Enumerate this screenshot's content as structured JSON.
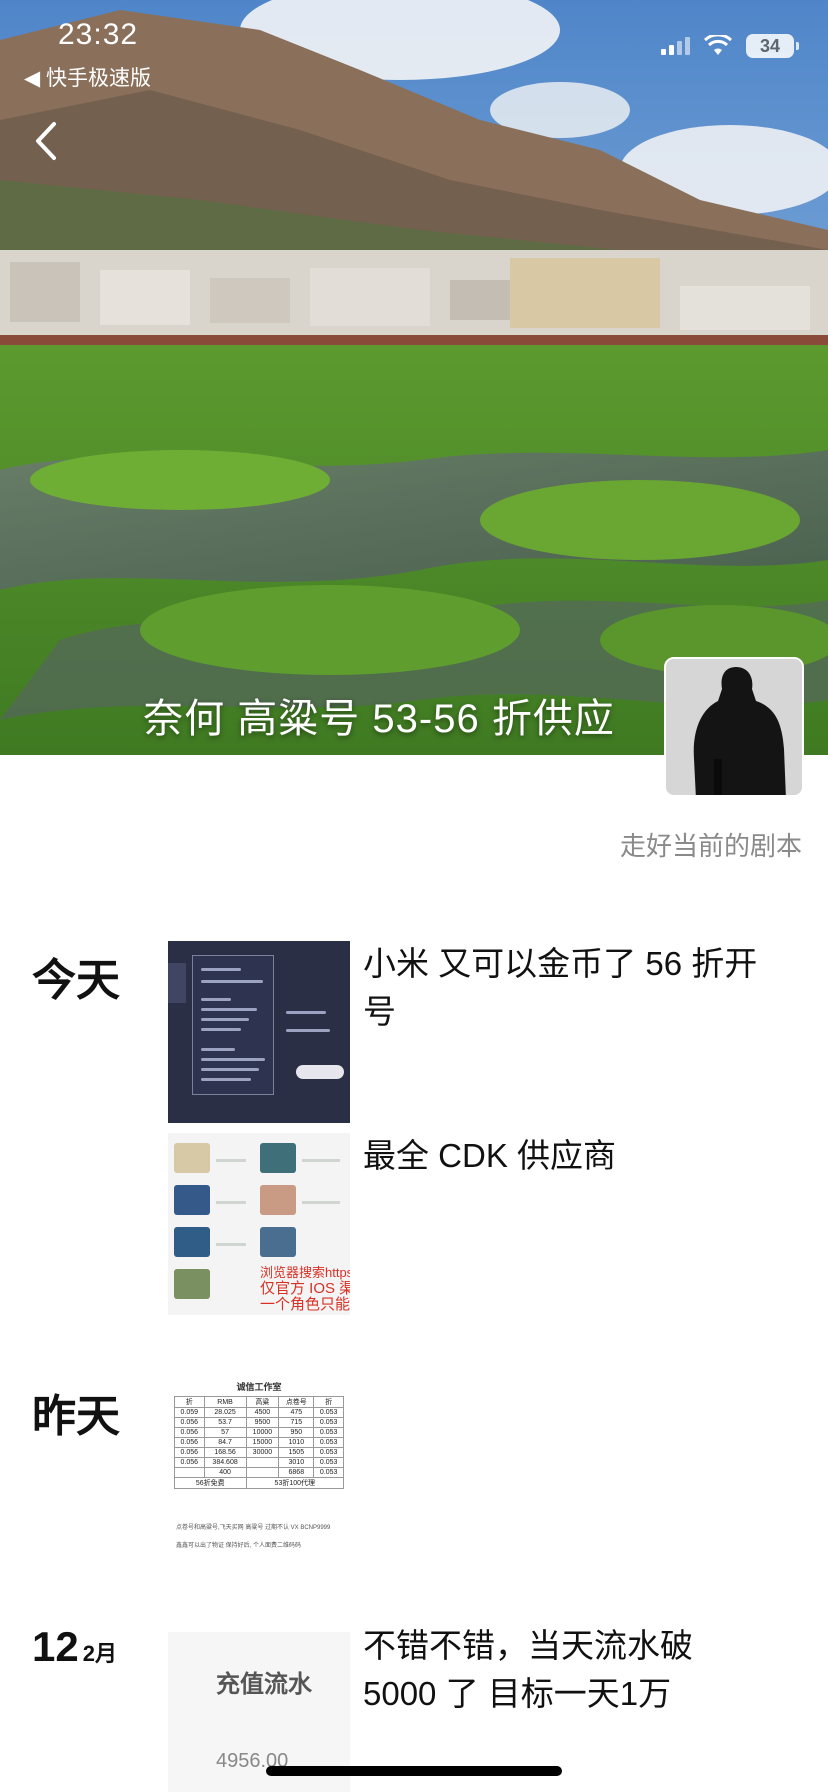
{
  "status_bar": {
    "time": "23:32",
    "back_app": "◀ 快手极速版",
    "battery": "34"
  },
  "cover": {
    "title": "奈何 高粱号 53-56 折供应"
  },
  "profile": {
    "signature": "走好当前的剧本"
  },
  "feed": [
    {
      "day": "今天",
      "posts": [
        {
          "text": "小米 又可以金币了 56 折开号"
        },
        {
          "text": "最全 CDK 供应商",
          "thumb_red_lines": [
            "浏览器搜索https",
            "仅官方 IOS 渠",
            "一个角色只能"
          ]
        }
      ]
    },
    {
      "day": "昨天",
      "posts": [
        {
          "text": "",
          "thumb_title": "诚信工作室",
          "thumb_table": {
            "headers": [
              "折",
              "RMB",
              "高粱",
              "点卷号",
              "折"
            ],
            "rows": [
              [
                "0.059",
                "28.025",
                "4500",
                "475",
                "0.053"
              ],
              [
                "0.056",
                "53.7",
                "9500",
                "715",
                "0.053"
              ],
              [
                "0.056",
                "57",
                "10000",
                "950",
                "0.053"
              ],
              [
                "0.056",
                "84.7",
                "15000",
                "1010",
                "0.053"
              ],
              [
                "0.056",
                "168.56",
                "30000",
                "1505",
                "0.053"
              ],
              [
                "0.056",
                "384.608",
                "",
                "3010",
                "0.053"
              ],
              [
                "",
                "400",
                "",
                "6868",
                "0.053"
              ]
            ],
            "footer_left": "56折免费",
            "footer_right": "53折100代理"
          },
          "thumb_notes": [
            "点卷号和高粱号,飞天买网 高粱号 过期不认 VX BCNP9999",
            "鑫鑫可以出了物证 保持好后, 个人面费二维码码"
          ]
        }
      ]
    },
    {
      "day_num": "12",
      "day_month": "2月",
      "posts": [
        {
          "text": "不错不错，当天流水破 5000 了 目标一天1万",
          "thumb_label": "充值流水",
          "thumb_value": "4956.00"
        }
      ]
    }
  ]
}
